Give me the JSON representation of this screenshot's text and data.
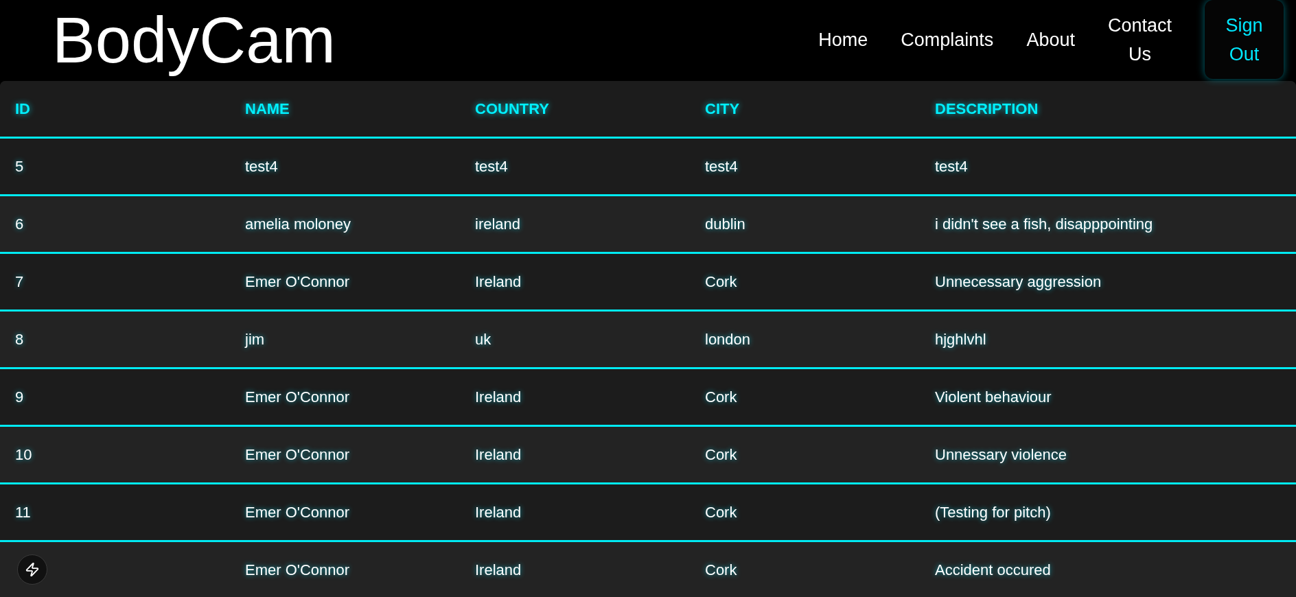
{
  "header": {
    "title": "BodyCam",
    "nav": [
      {
        "label": "Home"
      },
      {
        "label": "Complaints"
      },
      {
        "label": "About"
      },
      {
        "label": "Contact Us"
      }
    ],
    "sign_out_button": {
      "label": "Sign Out"
    }
  },
  "table": {
    "columns": [
      "ID",
      "NAME",
      "COUNTRY",
      "CITY",
      "DESCRIPTION"
    ],
    "rows": [
      {
        "id": "5",
        "name": "test4",
        "country": "test4",
        "city": "test4",
        "description": "test4"
      },
      {
        "id": "6",
        "name": "amelia moloney",
        "country": "ireland",
        "city": "dublin",
        "description": "i didn't see a fish, disapppointing"
      },
      {
        "id": "7",
        "name": "Emer O'Connor",
        "country": "Ireland",
        "city": "Cork",
        "description": "Unnecessary aggression"
      },
      {
        "id": "8",
        "name": "jim",
        "country": "uk",
        "city": "london",
        "description": "hjghlvhl"
      },
      {
        "id": "9",
        "name": "Emer O'Connor",
        "country": "Ireland",
        "city": "Cork",
        "description": "Violent behaviour"
      },
      {
        "id": "10",
        "name": "Emer O'Connor",
        "country": "Ireland",
        "city": "Cork",
        "description": "Unnessary violence"
      },
      {
        "id": "11",
        "name": "Emer O'Connor",
        "country": "Ireland",
        "city": "Cork",
        "description": "(Testing for pitch)"
      },
      {
        "name": "Emer O'Connor",
        "country": "Ireland",
        "city": "Cork",
        "description": "Accident occured"
      }
    ]
  }
}
